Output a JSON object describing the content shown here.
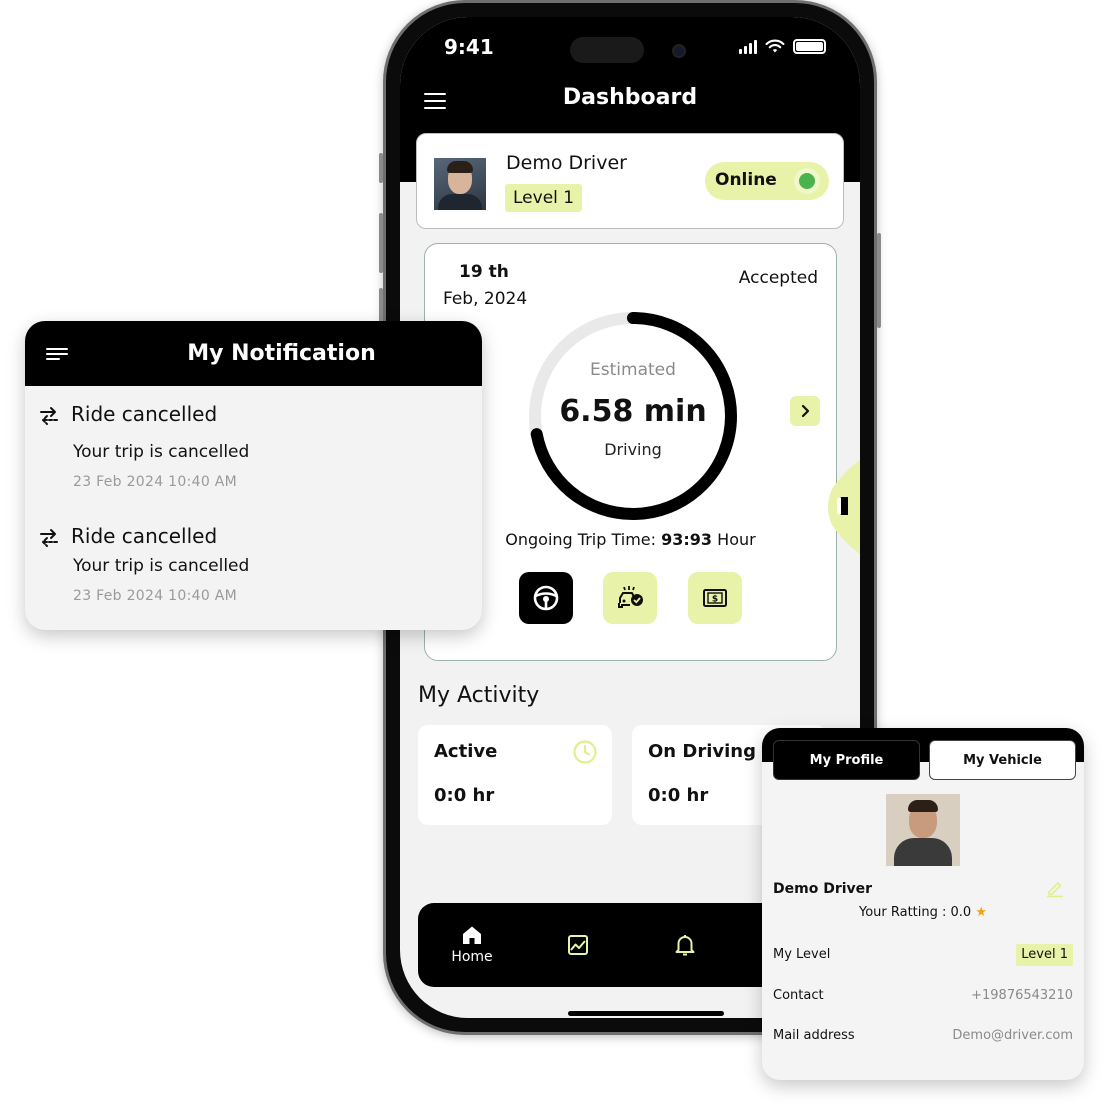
{
  "status_bar": {
    "time": "9:41"
  },
  "dashboard": {
    "title": "Dashboard",
    "driver": {
      "name": "Demo Driver",
      "level": "Level 1",
      "status_label": "Online"
    },
    "trip": {
      "date_day": "19 th",
      "date_month": "Feb, 2024",
      "status": "Accepted",
      "gauge_top_label": "Estimated",
      "gauge_value": "6.58 min",
      "gauge_bottom_label": "Driving",
      "gauge_progress": 0.72,
      "ongoing_label": "Ongoing Trip Time:",
      "ongoing_value": "93:93",
      "ongoing_unit": "Hour"
    },
    "activity": {
      "title": "My Activity",
      "cards": [
        {
          "title": "Active",
          "value": "0:0 hr"
        },
        {
          "title": "On Driving",
          "value": "0:0 hr"
        }
      ]
    },
    "nav": {
      "home_label": "Home"
    }
  },
  "notifications": {
    "title": "My Notification",
    "items": [
      {
        "title": "Ride cancelled",
        "body": "Your trip is cancelled",
        "date": "23 Feb 2024  10:40 AM"
      },
      {
        "title": "Ride cancelled",
        "body": "Your trip is cancelled",
        "date": "23 Feb 2024  10:40 AM"
      }
    ]
  },
  "profile": {
    "tabs": {
      "profile": "My Profile",
      "vehicle": "My Vehicle"
    },
    "name": "Demo Driver",
    "rating_label": "Your Ratting : 0.0",
    "rows": {
      "level_label": "My Level",
      "level_value": "Level 1",
      "contact_label": "Contact",
      "contact_value": "+19876543210",
      "mail_label": "Mail address",
      "mail_value": "Demo@driver.com"
    }
  },
  "colors": {
    "accent": "#e8f2a8",
    "online_dot": "#4bb34b",
    "star": "#f2a30f",
    "dark": "#000000"
  },
  "icons": [
    "menu-icon",
    "clock-icon",
    "steering-wheel-icon",
    "car-check-icon",
    "money-icon",
    "home-icon",
    "chart-icon",
    "bell-icon",
    "swap-arrows-icon",
    "edit-icon",
    "star-icon",
    "chevron-right-icon"
  ]
}
